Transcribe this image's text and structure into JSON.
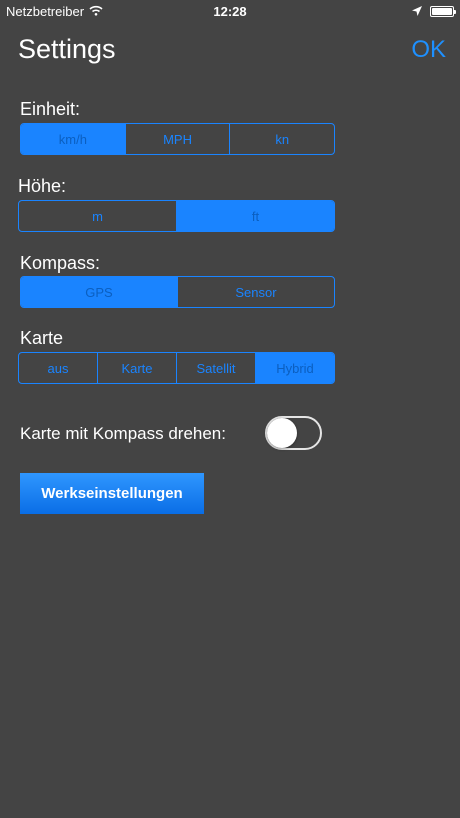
{
  "status_bar": {
    "carrier": "Netzbetreiber",
    "time": "12:28"
  },
  "header": {
    "title": "Settings",
    "ok_label": "OK"
  },
  "units": {
    "label": "Einheit:",
    "options": [
      "km/h",
      "MPH",
      "kn"
    ],
    "selected": "km/h"
  },
  "altitude": {
    "label": "Höhe:",
    "options": [
      "m",
      "ft"
    ],
    "selected": "ft"
  },
  "compass": {
    "label": "Kompass:",
    "options": [
      "GPS",
      "Sensor"
    ],
    "selected": "GPS"
  },
  "map": {
    "label": "Karte",
    "options": [
      "aus",
      "Karte",
      "Satellit",
      "Hybrid"
    ],
    "selected": "Hybrid"
  },
  "rotate_map": {
    "label": "Karte mit Kompass drehen:",
    "enabled": false
  },
  "reset": {
    "label": "Werkseinstellungen"
  },
  "colors": {
    "background": "#444444",
    "accent": "#1a84ff",
    "text": "#ffffff"
  }
}
